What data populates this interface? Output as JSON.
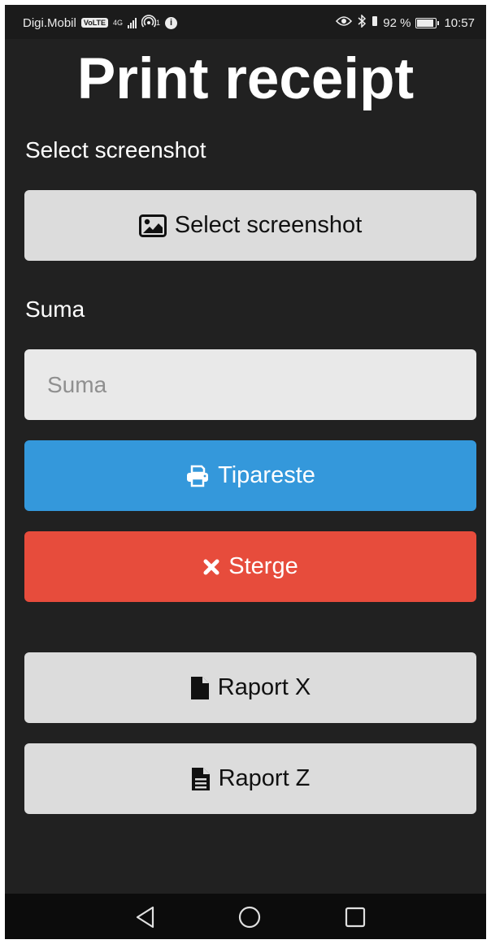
{
  "status_bar": {
    "carrier": "Digi.Mobil",
    "volte": "VoLTE",
    "network": "4G",
    "hotspot_count": "1",
    "battery_percent": "92 %",
    "time": "10:57"
  },
  "page": {
    "title": "Print receipt",
    "select_label": "Select screenshot",
    "select_button": "Select screenshot",
    "amount_label": "Suma",
    "amount_placeholder": "Suma",
    "amount_value": "",
    "print_button": "Tipareste",
    "delete_button": "Sterge",
    "report_x_button": "Raport X",
    "report_z_button": "Raport Z"
  },
  "colors": {
    "background": "#212121",
    "button_gray": "#dcdcdc",
    "button_blue": "#3498db",
    "button_red": "#e74c3c"
  },
  "icons": {
    "select": "image-icon",
    "print": "printer-icon",
    "delete": "close-icon",
    "report_x": "file-icon",
    "report_z": "file-text-icon"
  }
}
